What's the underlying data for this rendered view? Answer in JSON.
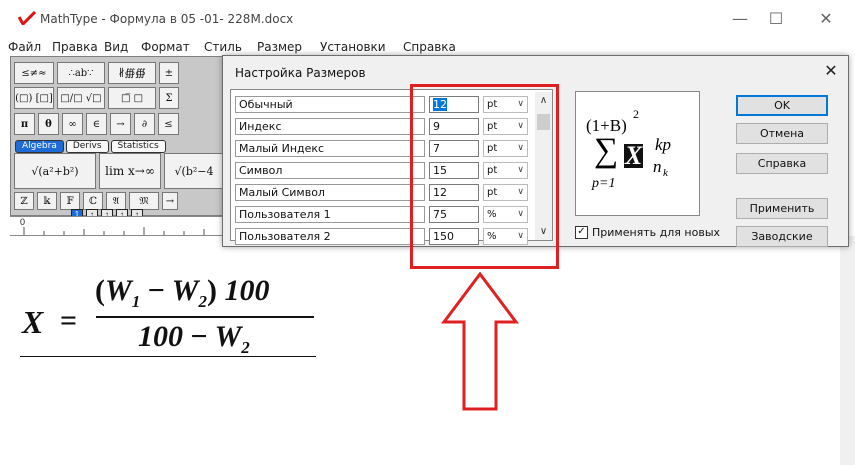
{
  "window": {
    "title": "MathType - Формула в 05 -01- 228M.docx",
    "minimize": "—",
    "maximize": "☐",
    "close": "✕"
  },
  "menu": [
    "Файл",
    "Правка",
    "Вид",
    "Формат",
    "Стиль",
    "Размер",
    "Установки",
    "Справка"
  ],
  "palette": {
    "row1": [
      "≤≠≈",
      "∴ab∵",
      "∦∰∰",
      "±"
    ],
    "row2": [
      "(□) [□]",
      "□/□ √□",
      "□̅ □",
      "Σ"
    ],
    "row3": [
      "π",
      "θ",
      "∞",
      "∈",
      "→",
      "∂",
      "≤"
    ],
    "tabs": [
      "Algebra",
      "Derivs",
      "Statistics"
    ],
    "big": [
      "√(a²+b²)",
      "lim x→∞",
      "√(b²−4"
    ],
    "row5": [
      "ℤ",
      "𝕜",
      "𝔽",
      "ℂ",
      "𝔄",
      "𝔐",
      "→"
    ],
    "tab_icons": [
      "1",
      "↑",
      "↑",
      "↑",
      "↑"
    ]
  },
  "ruler": {
    "origin": "0"
  },
  "formula": {
    "lhs": "X",
    "eq": "=",
    "num_open": "(",
    "w1": "W",
    "w1_sub": "1",
    "minus": "−",
    "w2": "W",
    "w2_sub": "2",
    "num_close": ")",
    "num_tail": "100",
    "den_head": "100",
    "den_minus": "−",
    "den_w": "W",
    "den_sub": "2"
  },
  "dialog": {
    "title": "Настройка Размеров",
    "close": "✕",
    "rows": [
      {
        "label": "Обычный",
        "value": "12",
        "unit": "pt"
      },
      {
        "label": "Индекс",
        "value": "9",
        "unit": "pt"
      },
      {
        "label": "Малый Индекс",
        "value": "7",
        "unit": "pt"
      },
      {
        "label": "Символ",
        "value": "15",
        "unit": "pt"
      },
      {
        "label": "Малый Символ",
        "value": "12",
        "unit": "pt"
      },
      {
        "label": "Пользователя 1",
        "value": "75",
        "unit": "%"
      },
      {
        "label": "Пользователя 2",
        "value": "150",
        "unit": "%"
      }
    ],
    "chevron": "∨",
    "scroll_up": "∧",
    "scroll_down": "∨",
    "preview": {
      "paren": "(1+B)",
      "sq": "2",
      "sigma": "∑",
      "p1": "p=1",
      "x": "X",
      "kp": "kp",
      "nk": "n",
      "k": "k"
    },
    "apply_new": "Применять для новых",
    "apply_new_checked": true,
    "buttons": {
      "ok": "OK",
      "cancel": "Отмена",
      "help": "Справка",
      "apply": "Применить",
      "factory": "Заводские"
    }
  },
  "colors": {
    "highlight": "#e02020",
    "selection": "#0078d7"
  }
}
